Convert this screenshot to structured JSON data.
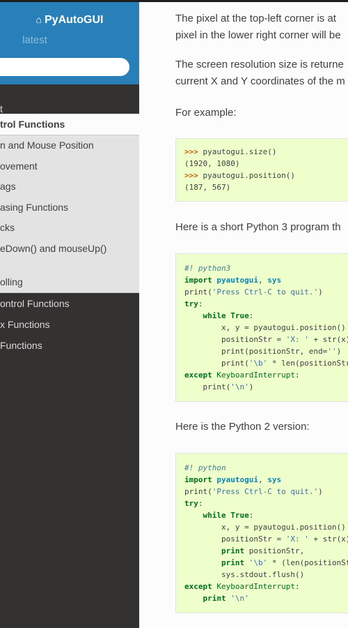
{
  "sidebar": {
    "brand": "PyAutoGUI",
    "version": "latest",
    "search_placeholder": "",
    "items": [
      {
        "label": "t"
      },
      {
        "label": "trol Functions"
      },
      {
        "label": "n and Mouse Position"
      },
      {
        "label": "ovement"
      },
      {
        "label": "ags"
      },
      {
        "label": "asing Functions"
      },
      {
        "label": "cks"
      },
      {
        "label": "eDown() and mouseUp()"
      },
      {
        "label": "olling"
      },
      {
        "label": "ontrol Functions"
      },
      {
        "label": "x Functions"
      },
      {
        "label": "Functions"
      }
    ]
  },
  "content": {
    "p1_line1": "The pixel at the top-left corner is at",
    "p1_line2": "pixel in the lower right corner will be",
    "p2_line1": "The screen resolution size is returne",
    "p2_line2": "current X and Y coordinates of the m",
    "p3": "For example:",
    "code1": [
      ">>> pyautogui.size()",
      "(1920, 1080)",
      ">>> pyautogui.position()",
      "(187, 567)"
    ],
    "p4": "Here is a short Python 3 program th",
    "code2": [
      "#! python3",
      "import pyautogui, sys",
      "print('Press Ctrl-C to quit.')",
      "try:",
      "    while True:",
      "        x, y = pyautogui.position()",
      "        positionStr = 'X: ' + str(x)",
      "        print(positionStr, end='')",
      "        print('\\b' * len(positionStr",
      "except KeyboardInterrupt:",
      "    print('\\n')"
    ],
    "p5": "Here is the Python 2 version:",
    "code3": [
      "#! python",
      "import pyautogui, sys",
      "print('Press Ctrl-C to quit.')",
      "try:",
      "    while True:",
      "        x, y = pyautogui.position()",
      "        positionStr = 'X: ' + str(x)",
      "        print positionStr,",
      "        print '\\b' * (len(positionSt",
      "        sys.stdout.flush()",
      "except KeyboardInterrupt:",
      "    print '\\n'"
    ]
  },
  "colors": {
    "sidebar_bg": "#343131",
    "sidebar_top": "#2980b9",
    "code_bg": "#eeffcc"
  }
}
